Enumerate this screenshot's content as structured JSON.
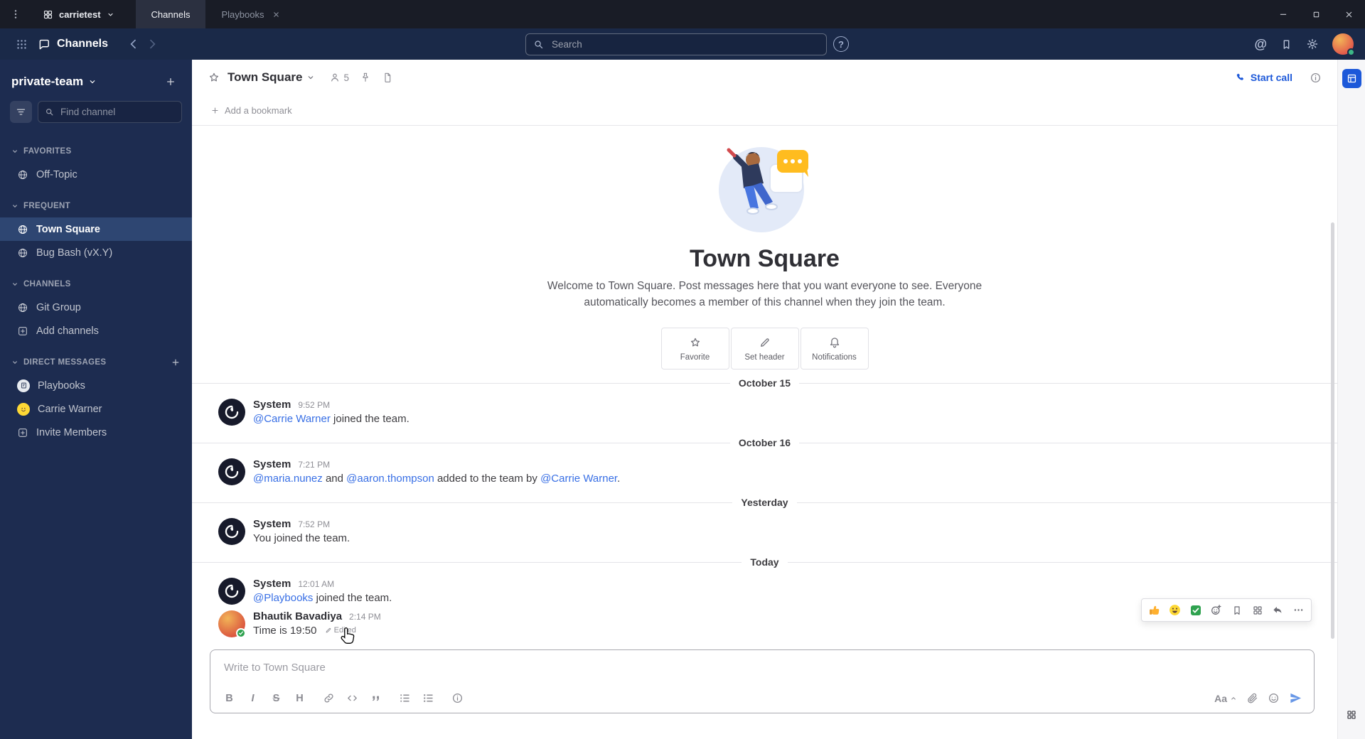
{
  "colors": {
    "accent": "#1c58d9",
    "link": "#386fe5",
    "online": "#3db887",
    "sidebar_bg": "#1d2c50",
    "titlebar_bg": "#191c26"
  },
  "titlebar": {
    "team_name": "carrietest",
    "tab_channels": "Channels",
    "tab_playbooks": "Playbooks"
  },
  "global_header": {
    "product_label": "Channels",
    "search_placeholder": "Search"
  },
  "sidebar": {
    "team_name": "private-team",
    "find_placeholder": "Find channel",
    "section_favorites": "FAVORITES",
    "section_frequent": "FREQUENT",
    "section_channels": "CHANNELS",
    "section_dms": "DIRECT MESSAGES",
    "favorites": [
      {
        "label": "Off-Topic"
      }
    ],
    "frequent": [
      {
        "label": "Town Square"
      },
      {
        "label": "Bug Bash (vX.Y)"
      }
    ],
    "channels": [
      {
        "label": "Git Group"
      },
      {
        "label": "Add channels"
      }
    ],
    "dms": [
      {
        "label": "Playbooks"
      },
      {
        "label": "Carrie Warner"
      },
      {
        "label": "Invite Members"
      }
    ]
  },
  "channel_header": {
    "name": "Town Square",
    "member_count": "5",
    "start_call_label": "Start call"
  },
  "bookmark_bar": {
    "label": "Add a bookmark"
  },
  "intro": {
    "title": "Town Square",
    "description": "Welcome to Town Square. Post messages here that you want everyone to see. Everyone automatically becomes a member of this channel when they join the team.",
    "action_favorite": "Favorite",
    "action_set_header": "Set header",
    "action_notifications": "Notifications"
  },
  "separators": [
    "October 15",
    "October 16",
    "Yesterday",
    "Today"
  ],
  "messages": [
    {
      "user": "System",
      "time": "9:52 PM",
      "link1": "@Carrie Warner",
      "text1": " joined the team."
    },
    {
      "user": "System",
      "time": "7:21 PM",
      "link1": "@maria.nunez",
      "text1": " and ",
      "link2": "@aaron.thompson",
      "text2": " added to the team by ",
      "link3": "@Carrie Warner",
      "text3": "."
    },
    {
      "user": "System",
      "time": "7:52 PM",
      "text1": "You joined the team."
    },
    {
      "user": "System",
      "time": "12:01 AM",
      "link1": "@Playbooks",
      "text1": " joined the team."
    },
    {
      "user": "Bhautik Bavadiya",
      "time": "2:14 PM",
      "text1": "Time is 19:50",
      "edited_label": "Edited"
    }
  ],
  "composer": {
    "placeholder": "Write to Town Square",
    "bold_label": "B",
    "italic_label": "I",
    "strike_label": "S",
    "heading_label": "H",
    "aa_label": "Aa"
  }
}
